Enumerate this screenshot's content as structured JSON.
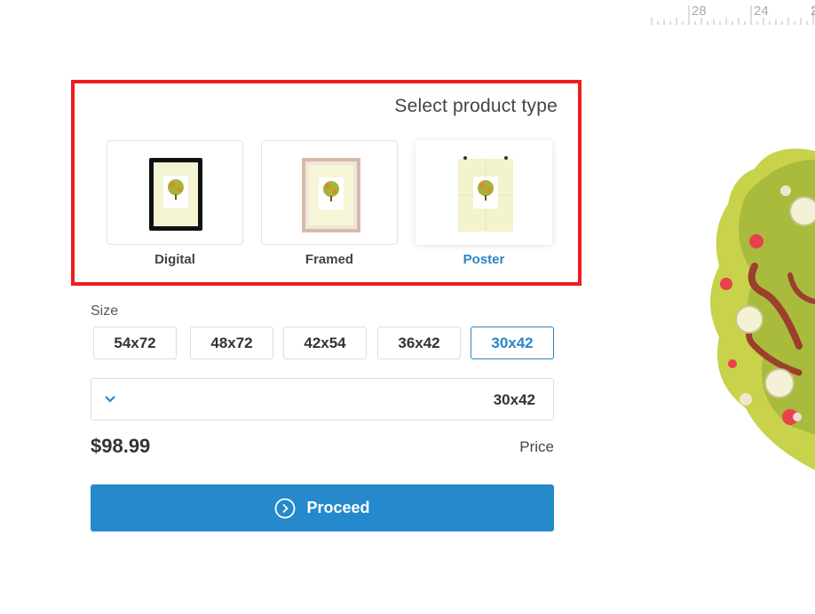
{
  "ruler": {
    "labels": [
      "28",
      "24",
      "2"
    ]
  },
  "product_type": {
    "title": "Select product type",
    "options": [
      {
        "label": "Digital",
        "selected": false
      },
      {
        "label": "Framed",
        "selected": false
      },
      {
        "label": "Poster",
        "selected": true
      }
    ]
  },
  "size": {
    "label": "Size",
    "options": [
      "54x72",
      "48x72",
      "42x54",
      "36x42",
      "30x42"
    ],
    "selected": "30x42"
  },
  "dropdown": {
    "value": "30x42",
    "icon": "chevron-down-icon"
  },
  "price": {
    "amount": "$98.99",
    "label": "Price"
  },
  "proceed": {
    "label": "Proceed",
    "icon": "chevron-right-circle-icon"
  },
  "colors": {
    "accent": "#2589cb",
    "highlight_border": "#ee1c1c",
    "selected_text": "#2a85c6"
  }
}
